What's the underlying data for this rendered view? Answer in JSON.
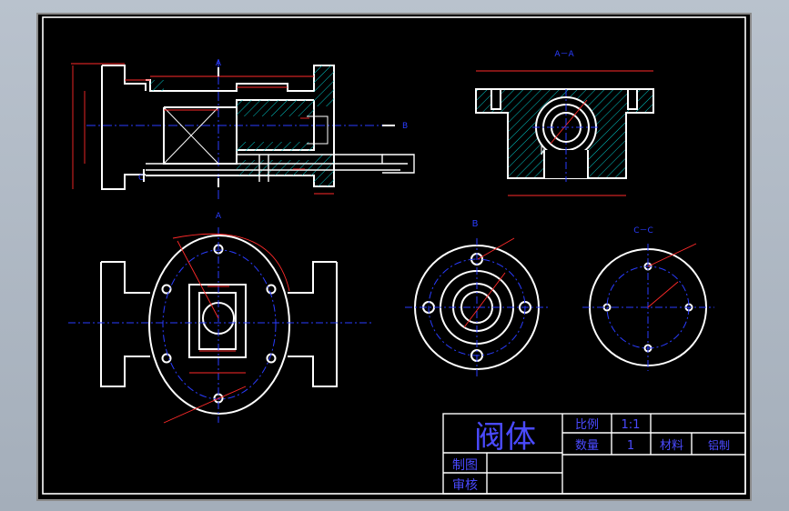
{
  "colors": {
    "paper": "#000000",
    "line": "#ffffff",
    "dim": "#ff2a2a",
    "center": "#2a3cff",
    "hatch": "#00c8c8",
    "accent": "#3cc8ff",
    "title_blue": "#4a4aff"
  },
  "views": {
    "section_a_mark": "A",
    "section_b_mark": "B",
    "section_aa_label": "A－A",
    "view_b_label": "B",
    "view_c_label": "C－C"
  },
  "title_block": {
    "part_name": "阀体",
    "scale_label": "比例",
    "scale_value": "1:1",
    "qty_label": "数量",
    "qty_value": "1",
    "material_label": "材料",
    "material_value": "铝制",
    "drawn_label": "制图",
    "checked_label": "审核"
  }
}
